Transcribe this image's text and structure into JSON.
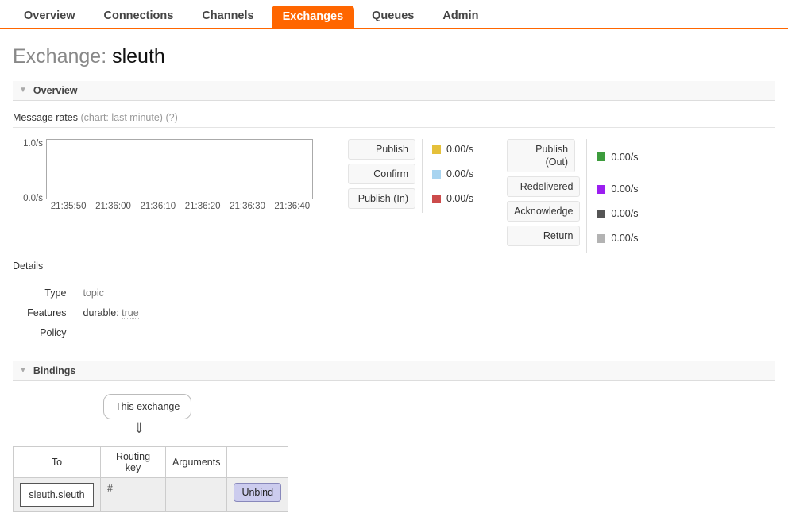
{
  "nav": {
    "tabs": [
      {
        "label": "Overview",
        "active": false
      },
      {
        "label": "Connections",
        "active": false
      },
      {
        "label": "Channels",
        "active": false
      },
      {
        "label": "Exchanges",
        "active": true
      },
      {
        "label": "Queues",
        "active": false
      },
      {
        "label": "Admin",
        "active": false
      }
    ]
  },
  "page": {
    "title_prefix": "Exchange:",
    "title_name": "sleuth"
  },
  "overview": {
    "section_label": "Overview",
    "caret_icon": "▼",
    "message_rates_label": "Message rates",
    "message_rates_note": "(chart: last minute)",
    "help_link": "(?)"
  },
  "chart_data": {
    "type": "line",
    "title": "Message rates (chart: last minute)",
    "xlabel": "",
    "ylabel": "",
    "ylim": [
      0,
      1
    ],
    "y_ticks": [
      "0.0/s",
      "1.0/s"
    ],
    "y_max_label": "1.0/s",
    "y_min_label": "0.0/s",
    "grid": false,
    "legend_position": "right",
    "x_ticks": [
      "21:35:50",
      "21:36:00",
      "21:36:10",
      "21:36:20",
      "21:36:30",
      "21:36:40"
    ],
    "series": [
      {
        "name": "Publish",
        "color": "#e5c03a",
        "values": [
          0,
          0,
          0,
          0,
          0,
          0
        ],
        "rate": "0.00/s"
      },
      {
        "name": "Confirm",
        "color": "#a8d4f0",
        "values": [
          0,
          0,
          0,
          0,
          0,
          0
        ],
        "rate": "0.00/s"
      },
      {
        "name": "Publish (In)",
        "color": "#cc4b4b",
        "values": [
          0,
          0,
          0,
          0,
          0,
          0
        ],
        "rate": "0.00/s"
      },
      {
        "name": "Publish (Out)",
        "color": "#3d9c3d",
        "values": [
          0,
          0,
          0,
          0,
          0,
          0
        ],
        "rate": "0.00/s"
      },
      {
        "name": "Redelivered",
        "color": "#9b1ef0",
        "values": [
          0,
          0,
          0,
          0,
          0,
          0
        ],
        "rate": "0.00/s"
      },
      {
        "name": "Acknowledge",
        "color": "#555555",
        "values": [
          0,
          0,
          0,
          0,
          0,
          0
        ],
        "rate": "0.00/s"
      },
      {
        "name": "Return",
        "color": "#b3b3b3",
        "values": [
          0,
          0,
          0,
          0,
          0,
          0
        ],
        "rate": "0.00/s"
      }
    ]
  },
  "rates_left": [
    {
      "label": "Publish",
      "rate": "0.00/s",
      "color": "#e5c03a"
    },
    {
      "label": "Confirm",
      "rate": "0.00/s",
      "color": "#a8d4f0"
    },
    {
      "label": "Publish (In)",
      "rate": "0.00/s",
      "color": "#cc4b4b"
    }
  ],
  "rates_right": [
    {
      "label": "Publish (Out)",
      "rate": "0.00/s",
      "color": "#3d9c3d"
    },
    {
      "label": "Redelivered",
      "rate": "0.00/s",
      "color": "#9b1ef0"
    },
    {
      "label": "Acknowledge",
      "rate": "0.00/s",
      "color": "#555555"
    },
    {
      "label": "Return",
      "rate": "0.00/s",
      "color": "#b3b3b3"
    }
  ],
  "details": {
    "heading": "Details",
    "rows": [
      {
        "label": "Type",
        "value": "topic"
      },
      {
        "label": "Features",
        "value_key": "durable:",
        "value_val": "true"
      },
      {
        "label": "Policy",
        "value": ""
      }
    ]
  },
  "bindings": {
    "section_label": "Bindings",
    "caret_icon": "▼",
    "this_exchange_label": "This exchange",
    "arrow_icon": "⇓",
    "columns": [
      "To",
      "Routing key",
      "Arguments",
      ""
    ],
    "rows": [
      {
        "to": "sleuth.sleuth",
        "routing_key": "#",
        "arguments": "",
        "action_label": "Unbind"
      }
    ]
  }
}
